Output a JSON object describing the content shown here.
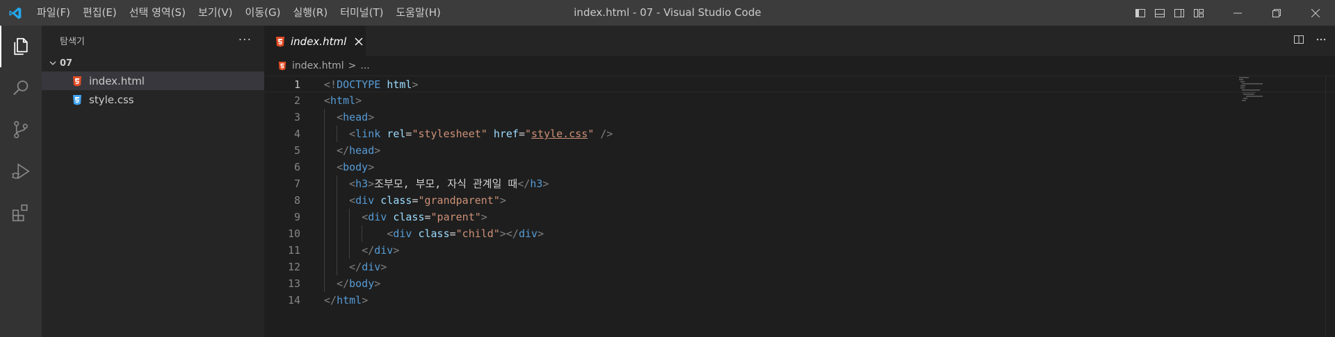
{
  "titlebar": {
    "menu": [
      "파일(F)",
      "편집(E)",
      "선택 영역(S)",
      "보기(V)",
      "이동(G)",
      "실행(R)",
      "터미널(T)",
      "도움말(H)"
    ],
    "window_title": "index.html - 07 - Visual Studio Code"
  },
  "sidebar": {
    "title": "탐색기",
    "more": "···",
    "folder": "07",
    "files": [
      {
        "name": "index.html",
        "type": "html"
      },
      {
        "name": "style.css",
        "type": "css"
      }
    ]
  },
  "editor": {
    "tab_label": "index.html",
    "breadcrumb": {
      "file": "index.html",
      "sep": ">",
      "rest": "..."
    },
    "lines": [
      {
        "no": "1",
        "code": [
          [
            "b",
            "<!"
          ],
          [
            "t",
            "DOCTYPE "
          ],
          [
            "a",
            "html"
          ],
          [
            "b",
            ">"
          ]
        ]
      },
      {
        "no": "2",
        "code": [
          [
            "b",
            "<"
          ],
          [
            "t",
            "html"
          ],
          [
            "b",
            ">"
          ]
        ]
      },
      {
        "no": "3",
        "code": [
          [
            "x",
            "  "
          ],
          [
            "b",
            "<"
          ],
          [
            "t",
            "head"
          ],
          [
            "b",
            ">"
          ]
        ]
      },
      {
        "no": "4",
        "code": [
          [
            "x",
            "    "
          ],
          [
            "b",
            "<"
          ],
          [
            "t",
            "link "
          ],
          [
            "a",
            "rel"
          ],
          [
            "x",
            "="
          ],
          [
            "s",
            "\"stylesheet\" "
          ],
          [
            "a",
            "href"
          ],
          [
            "x",
            "="
          ],
          [
            "s",
            "\""
          ],
          [
            "l",
            "style.css"
          ],
          [
            "s",
            "\""
          ],
          [
            "x",
            " "
          ],
          [
            "b",
            "/>"
          ]
        ]
      },
      {
        "no": "5",
        "code": [
          [
            "x",
            "  "
          ],
          [
            "b",
            "</"
          ],
          [
            "t",
            "head"
          ],
          [
            "b",
            ">"
          ]
        ]
      },
      {
        "no": "6",
        "code": [
          [
            "x",
            "  "
          ],
          [
            "b",
            "<"
          ],
          [
            "t",
            "body"
          ],
          [
            "b",
            ">"
          ]
        ]
      },
      {
        "no": "7",
        "code": [
          [
            "x",
            "    "
          ],
          [
            "b",
            "<"
          ],
          [
            "t",
            "h3"
          ],
          [
            "b",
            ">"
          ],
          [
            "x",
            "조부모, 부모, 자식 관계일 때"
          ],
          [
            "b",
            "</"
          ],
          [
            "t",
            "h3"
          ],
          [
            "b",
            ">"
          ]
        ]
      },
      {
        "no": "8",
        "code": [
          [
            "x",
            "    "
          ],
          [
            "b",
            "<"
          ],
          [
            "t",
            "div "
          ],
          [
            "a",
            "class"
          ],
          [
            "x",
            "="
          ],
          [
            "s",
            "\"grandparent\""
          ],
          [
            "b",
            ">"
          ]
        ]
      },
      {
        "no": "9",
        "code": [
          [
            "x",
            "      "
          ],
          [
            "b",
            "<"
          ],
          [
            "t",
            "div "
          ],
          [
            "a",
            "class"
          ],
          [
            "x",
            "="
          ],
          [
            "s",
            "\"parent\""
          ],
          [
            "b",
            ">"
          ]
        ]
      },
      {
        "no": "10",
        "code": [
          [
            "x",
            "          "
          ],
          [
            "b",
            "<"
          ],
          [
            "t",
            "div "
          ],
          [
            "a",
            "class"
          ],
          [
            "x",
            "="
          ],
          [
            "s",
            "\"child\""
          ],
          [
            "b",
            "></"
          ],
          [
            "t",
            "div"
          ],
          [
            "b",
            ">"
          ]
        ]
      },
      {
        "no": "11",
        "code": [
          [
            "x",
            "      "
          ],
          [
            "b",
            "</"
          ],
          [
            "t",
            "div"
          ],
          [
            "b",
            ">"
          ]
        ]
      },
      {
        "no": "12",
        "code": [
          [
            "x",
            "    "
          ],
          [
            "b",
            "</"
          ],
          [
            "t",
            "div"
          ],
          [
            "b",
            ">"
          ]
        ]
      },
      {
        "no": "13",
        "code": [
          [
            "x",
            "  "
          ],
          [
            "b",
            "</"
          ],
          [
            "t",
            "body"
          ],
          [
            "b",
            ">"
          ]
        ]
      },
      {
        "no": "14",
        "code": [
          [
            "b",
            "</"
          ],
          [
            "t",
            "html"
          ],
          [
            "b",
            ">"
          ]
        ]
      }
    ]
  },
  "colors": {
    "accent": "#0078d4",
    "html_icon": "#e44d26",
    "css_icon": "#42a5f5"
  }
}
